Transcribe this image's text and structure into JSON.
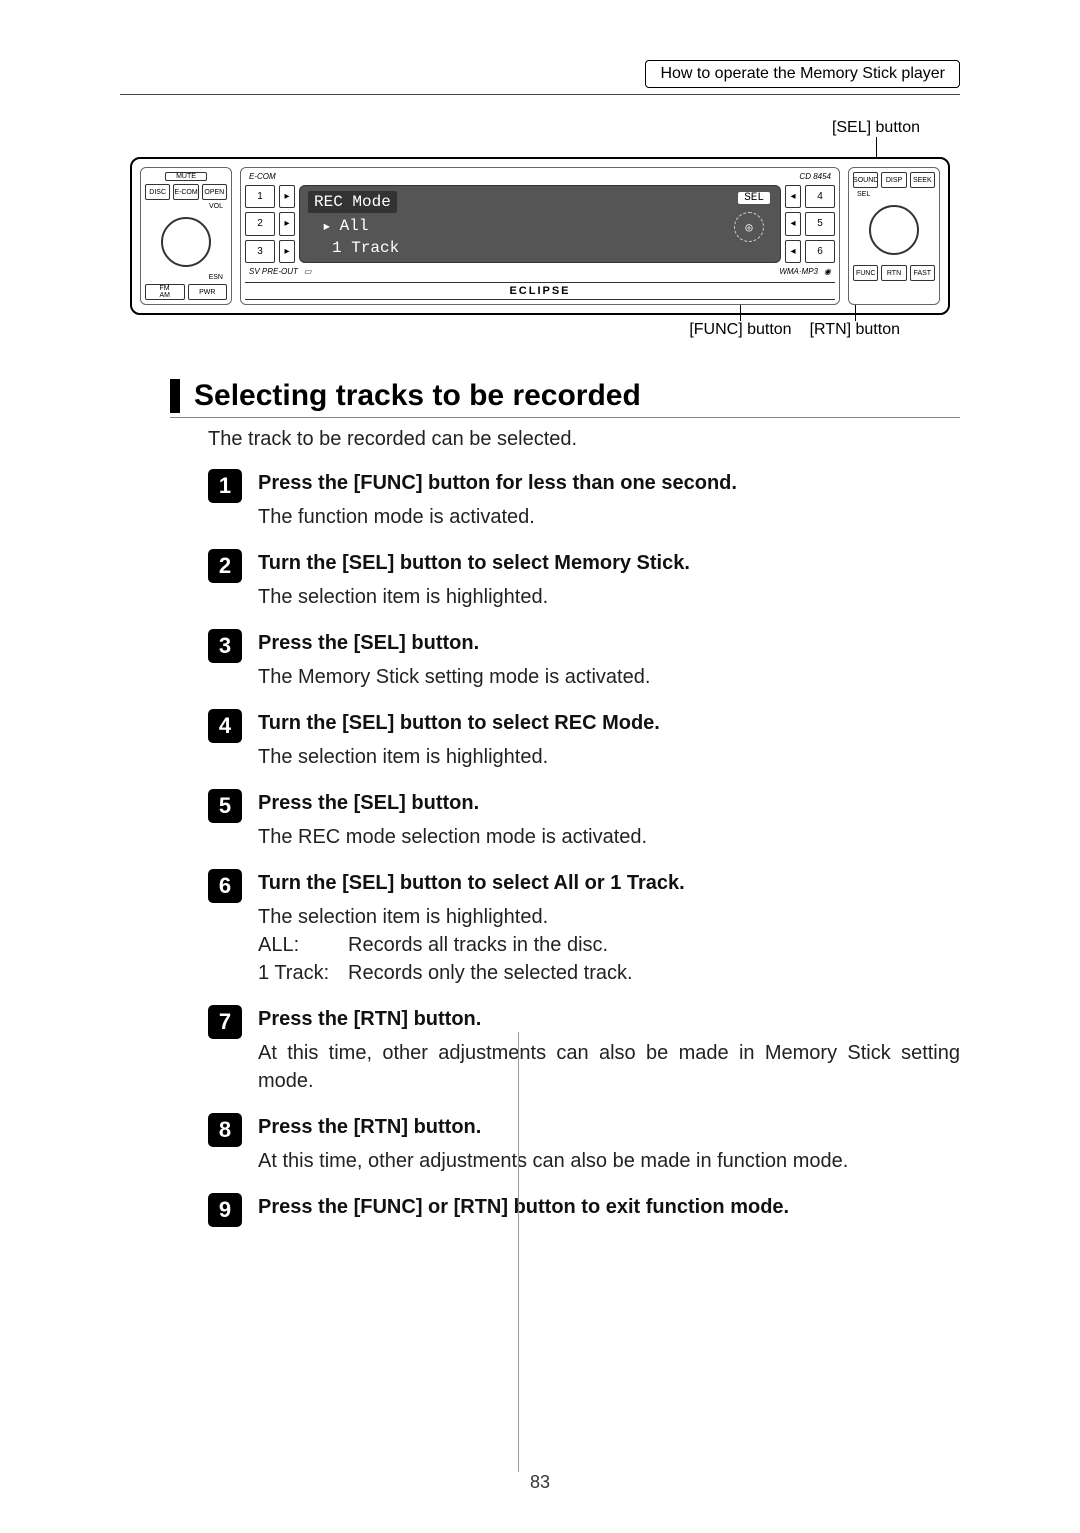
{
  "header": {
    "breadcrumb": "How to operate the Memory Stick player"
  },
  "callouts": {
    "sel": "[SEL] button",
    "func": "[FUNC] button",
    "rtn": "[RTN] button"
  },
  "stereo": {
    "model": "CD 8454",
    "ecom": "E-COM",
    "display": {
      "line1_label": "REC Mode",
      "line2_value": "All",
      "line3_value": "1 Track",
      "sel_box": "SEL"
    },
    "left_buttons": {
      "mute": "MUTE",
      "disc": "DISC",
      "ecom": "E-COM",
      "open": "OPEN",
      "vol": "VOL",
      "esn": "ESN",
      "fm_am": "FM\nAM",
      "pwr": "PWR"
    },
    "presets_left": [
      "1",
      "2",
      "3"
    ],
    "presets_right": [
      "4",
      "5",
      "6"
    ],
    "right_buttons": {
      "sound": "SOUND",
      "disp": "DISP",
      "seek": "SEEK",
      "sel": "SEL",
      "func": "FUNC",
      "rtn": "RTN",
      "fast": "FAST"
    },
    "bottom_logos": [
      "SV PRE-OUT",
      "WMA·MP3"
    ],
    "brand": "ECLIPSE"
  },
  "section": {
    "title": "Selecting tracks to be recorded",
    "intro": "The track to be recorded can be selected."
  },
  "steps": [
    {
      "n": "1",
      "title": "Press the [FUNC] button for less than one second.",
      "body": "The function mode is activated."
    },
    {
      "n": "2",
      "title": "Turn the [SEL] button to select Memory Stick.",
      "body": "The selection item is highlighted."
    },
    {
      "n": "3",
      "title": "Press the [SEL] button.",
      "body": "The Memory Stick setting mode is activated."
    },
    {
      "n": "4",
      "title": "Turn the [SEL] button to select REC Mode.",
      "body": "The selection item is highlighted."
    },
    {
      "n": "5",
      "title": "Press the [SEL] button.",
      "body": "The REC mode selection mode is activated."
    },
    {
      "n": "6",
      "title": "Turn the [SEL] button to select All or 1 Track.",
      "body": "The selection item is highlighted.",
      "options": [
        {
          "k": "ALL:",
          "v": "Records all tracks in the disc."
        },
        {
          "k": "1 Track:",
          "v": "Records only the selected track."
        }
      ]
    },
    {
      "n": "7",
      "title": "Press the [RTN] button.",
      "body": "At this time, other adjustments can also be made in Memory Stick setting mode.",
      "justify": true
    },
    {
      "n": "8",
      "title": "Press the [RTN] button.",
      "body": "At this time, other adjustments can also be made in function mode.",
      "justify": true
    },
    {
      "n": "9",
      "title": "Press the [FUNC] or [RTN] button to exit function mode."
    }
  ],
  "page_number": "83"
}
